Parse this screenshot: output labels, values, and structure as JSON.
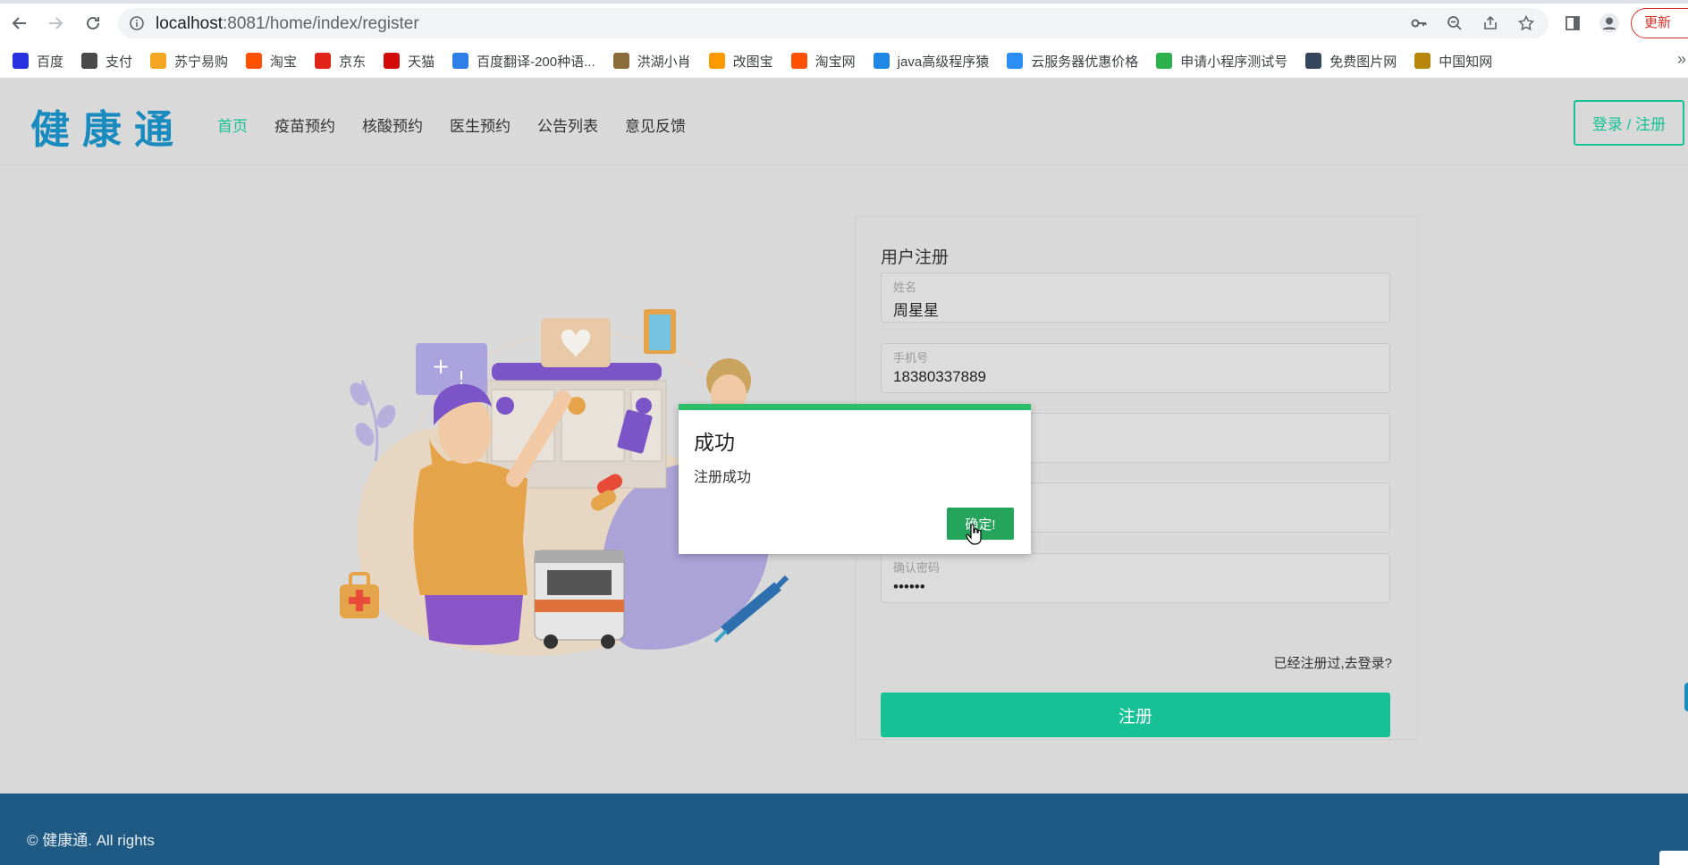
{
  "browser": {
    "url_host": "localhost",
    "url_path": ":8081/home/index/register",
    "update_label": "更新",
    "bookmarks": [
      {
        "label": "百度",
        "color": "#2932e1"
      },
      {
        "label": "支付",
        "color": "#4a4a4a"
      },
      {
        "label": "苏宁易购",
        "color": "#f5a623"
      },
      {
        "label": "淘宝",
        "color": "#ff5000"
      },
      {
        "label": "京东",
        "color": "#e1251b"
      },
      {
        "label": "天猫",
        "color": "#d20a0a"
      },
      {
        "label": "百度翻译-200种语...",
        "color": "#2f7fe8"
      },
      {
        "label": "洪湖小肖",
        "color": "#8a6d3b"
      },
      {
        "label": "改图宝",
        "color": "#ff9900"
      },
      {
        "label": "淘宝网",
        "color": "#ff5000"
      },
      {
        "label": "java高级程序猿",
        "color": "#1e88e5"
      },
      {
        "label": "云服务器优惠价格",
        "color": "#2c8df5"
      },
      {
        "label": "申请小程序测试号",
        "color": "#2bb24c"
      },
      {
        "label": "免费图片网",
        "color": "#35465c"
      },
      {
        "label": "中国知网",
        "color": "#b8860b"
      }
    ]
  },
  "header": {
    "logo": "健康通",
    "menu": [
      "首页",
      "疫苗预约",
      "核酸预约",
      "医生预约",
      "公告列表",
      "意见反馈"
    ],
    "login_label": "登录 / 注册"
  },
  "form": {
    "title": "用户注册",
    "fields": [
      {
        "label": "姓名",
        "value": "周星星"
      },
      {
        "label": "手机号",
        "value": "18380337889"
      },
      {
        "label": "",
        "value": ""
      },
      {
        "label": "",
        "value": ""
      },
      {
        "label": "确认密码",
        "value": "••••••"
      }
    ],
    "already_link": "已经注册过,去登录?",
    "submit_label": "注册"
  },
  "dialog": {
    "title": "成功",
    "message": "注册成功",
    "ok_label": "确定!"
  },
  "footer": {
    "text": "© 健康通. All rights"
  },
  "colors": {
    "accent": "#16c195",
    "logo": "#1a8bbf",
    "footer": "#1f5a84",
    "dialog_bar": "#2bbd6a"
  }
}
